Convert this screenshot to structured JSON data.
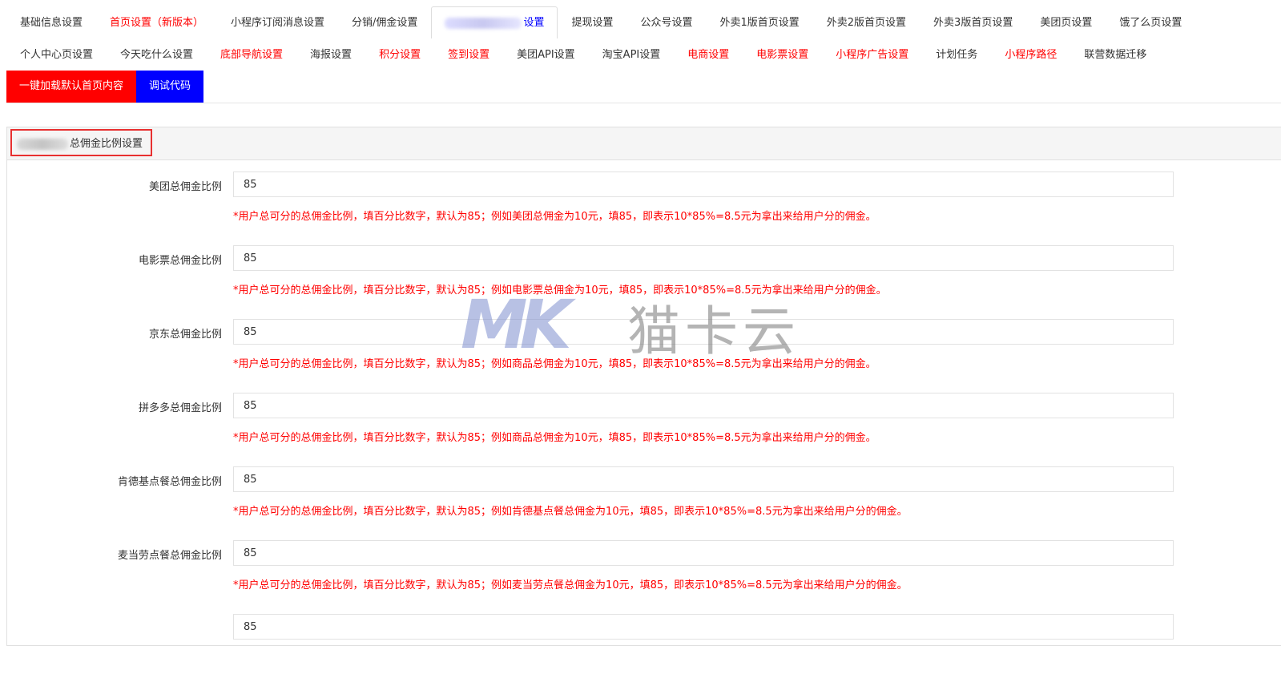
{
  "tabs_row1": [
    {
      "label": "基础信息设置",
      "color": "normal"
    },
    {
      "label": "首页设置（新版本）",
      "color": "red"
    },
    {
      "label": "小程序订阅消息设置",
      "color": "normal"
    },
    {
      "label": "分销/佣金设置",
      "color": "normal"
    },
    {
      "label": "设置",
      "color": "blue",
      "active": true,
      "redacted_prefix": true
    },
    {
      "label": "提现设置",
      "color": "normal"
    },
    {
      "label": "公众号设置",
      "color": "normal"
    },
    {
      "label": "外卖1版首页设置",
      "color": "normal"
    },
    {
      "label": "外卖2版首页设置",
      "color": "normal"
    },
    {
      "label": "外卖3版首页设置",
      "color": "normal"
    },
    {
      "label": "美团页设置",
      "color": "normal"
    },
    {
      "label": "饿了么页设置",
      "color": "normal"
    }
  ],
  "tabs_row2": [
    {
      "label": "个人中心页设置",
      "color": "normal"
    },
    {
      "label": "今天吃什么设置",
      "color": "normal"
    },
    {
      "label": "底部导航设置",
      "color": "red"
    },
    {
      "label": "海报设置",
      "color": "normal"
    },
    {
      "label": "积分设置",
      "color": "red"
    },
    {
      "label": "签到设置",
      "color": "red"
    },
    {
      "label": "美团API设置",
      "color": "normal"
    },
    {
      "label": "淘宝API设置",
      "color": "normal"
    },
    {
      "label": "电商设置",
      "color": "red"
    },
    {
      "label": "电影票设置",
      "color": "red"
    },
    {
      "label": "小程序广告设置",
      "color": "red"
    },
    {
      "label": "计划任务",
      "color": "normal"
    },
    {
      "label": "小程序路径",
      "color": "red"
    },
    {
      "label": "联营数据迁移",
      "color": "normal"
    }
  ],
  "actions": {
    "load_default": "一键加载默认首页内容",
    "debug_code": "调试代码"
  },
  "panel": {
    "title": "总佣金比例设置"
  },
  "fields": [
    {
      "label": "美团总佣金比例",
      "value": "85",
      "help": "*用户总可分的总佣金比例，填百分比数字，默认为85；例如美团总佣金为10元，填85，即表示10*85%=8.5元为拿出来给用户分的佣金。"
    },
    {
      "label": "电影票总佣金比例",
      "value": "85",
      "help": "*用户总可分的总佣金比例，填百分比数字，默认为85；例如电影票总佣金为10元，填85，即表示10*85%=8.5元为拿出来给用户分的佣金。"
    },
    {
      "label": "京东总佣金比例",
      "value": "85",
      "help": "*用户总可分的总佣金比例，填百分比数字，默认为85；例如商品总佣金为10元，填85，即表示10*85%=8.5元为拿出来给用户分的佣金。"
    },
    {
      "label": "拼多多总佣金比例",
      "value": "85",
      "help": "*用户总可分的总佣金比例，填百分比数字，默认为85；例如商品总佣金为10元，填85，即表示10*85%=8.5元为拿出来给用户分的佣金。"
    },
    {
      "label": "肯德基点餐总佣金比例",
      "value": "85",
      "help": "*用户总可分的总佣金比例，填百分比数字，默认为85；例如肯德基点餐总佣金为10元，填85，即表示10*85%=8.5元为拿出来给用户分的佣金。"
    },
    {
      "label": "麦当劳点餐总佣金比例",
      "value": "85",
      "help": "*用户总可分的总佣金比例，填百分比数字，默认为85；例如麦当劳点餐总佣金为10元，填85，即表示10*85%=8.5元为拿出来给用户分的佣金。"
    },
    {
      "label": "",
      "value": "85",
      "help": ""
    }
  ],
  "watermark": {
    "logo": "MK",
    "text": "猫卡云"
  },
  "colors": {
    "red": "#ff0000",
    "blue": "#0000ff",
    "highlight_border": "#e83030"
  }
}
